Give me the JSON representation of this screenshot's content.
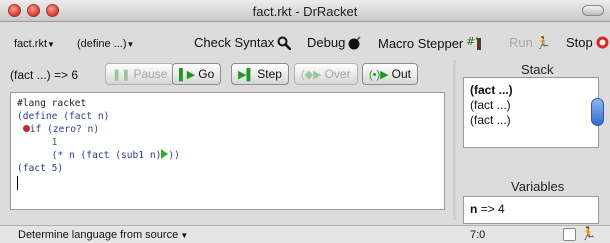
{
  "window": {
    "title": "fact.rkt - DrRacket"
  },
  "toolbar": {
    "file_menu": "fact.rkt",
    "define_menu": "(define ...)",
    "check_syntax": "Check Syntax",
    "debug": "Debug",
    "macro_stepper": "Macro Stepper",
    "run": "Run",
    "stop": "Stop"
  },
  "debugger": {
    "expression": "(fact ...) => 6",
    "pause": "Pause",
    "go": "Go",
    "step": "Step",
    "over": "Over",
    "out": "Out"
  },
  "editor": {
    "lines": [
      "#lang racket",
      "(define (fact n)",
      "if (zero? n)",
      "1",
      "(* n (fact (sub1 n)",
      "))",
      "(fact 5)"
    ]
  },
  "stack": {
    "label": "Stack",
    "items": [
      "(fact ...)",
      "(fact ...)",
      "(fact ...)"
    ]
  },
  "variables": {
    "label": "Variables",
    "name": "n",
    "arrow": "=>",
    "value": "4"
  },
  "status": {
    "language": "Determine language from source",
    "position": "7:0"
  },
  "colors": {
    "go_green": "#1f9a1f",
    "breakpoint_red": "#c1272d",
    "stop_red": "#e0241d"
  }
}
